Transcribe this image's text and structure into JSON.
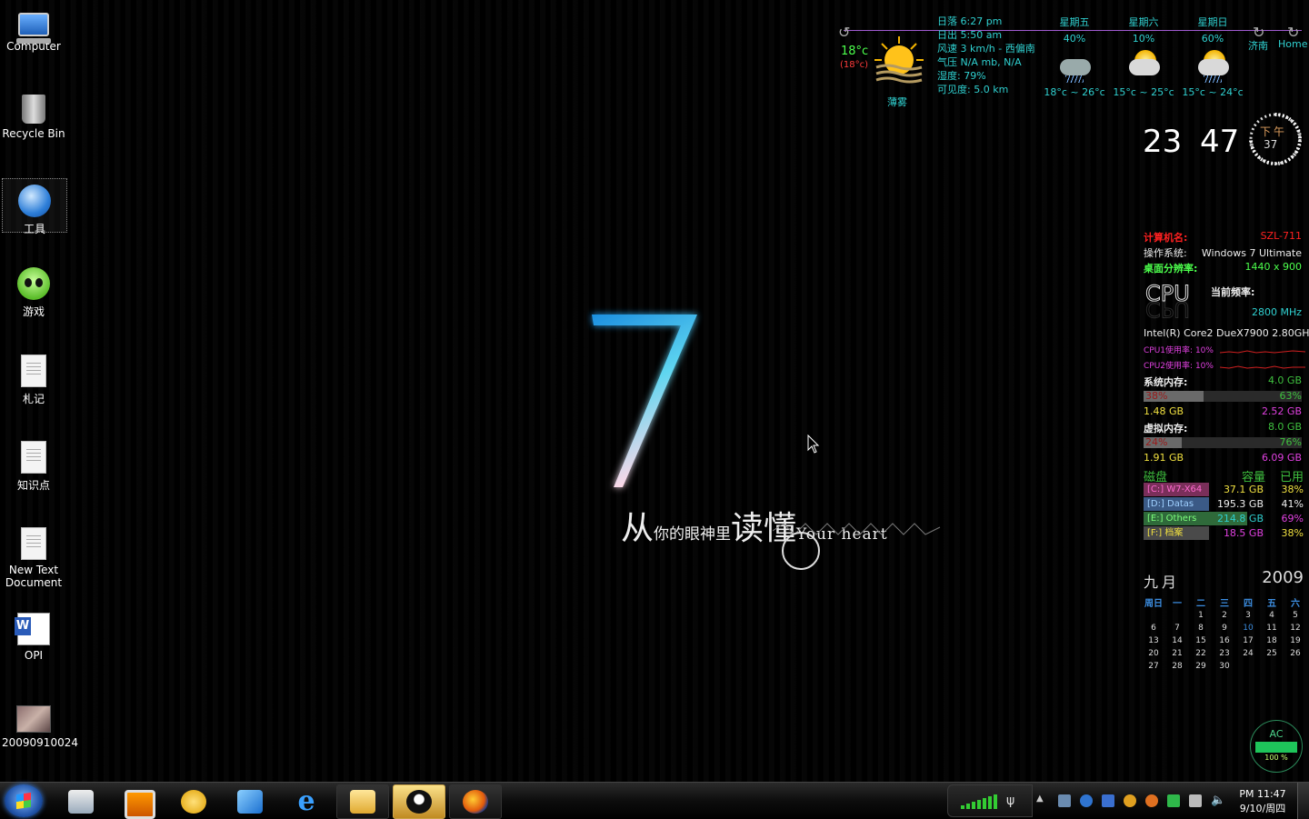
{
  "desktop_icons": [
    {
      "label": "Computer",
      "icon": "computer-icon"
    },
    {
      "label": "Recycle Bin",
      "icon": "recycle-bin-icon"
    },
    {
      "label": "工具",
      "icon": "tools-folder-icon"
    },
    {
      "label": "游戏",
      "icon": "alien-games-icon"
    },
    {
      "label": "札记",
      "icon": "text-document-icon"
    },
    {
      "label": "知识点",
      "icon": "text-document-icon"
    },
    {
      "label": "New Text Document",
      "icon": "text-document-icon"
    },
    {
      "label": "OPI",
      "icon": "word-document-icon"
    },
    {
      "label": "20090910024",
      "icon": "image-file-icon"
    }
  ],
  "wallpaper": {
    "numeral": "7",
    "slogan_big1": "从",
    "slogan_small": "你的眼神里",
    "slogan_big2": "读懂",
    "slogan_en": "Your heart"
  },
  "weather": {
    "current_temp": "18°c",
    "feels_like": "(18°c)",
    "current_condition": "薄雾",
    "sunset": "日落 6:27 pm",
    "sunrise": "日出 5:50 am",
    "wind": "风速 3 km/h - 西偏南",
    "pressure": "气压 N/A mb, N/A",
    "humidity": "湿度: 79%",
    "visibility": "可见度: 5.0 km",
    "forecast": [
      {
        "day": "星期五",
        "chance": "40%",
        "range": "18°c ~ 26°c",
        "icon": "thunderstorm-icon"
      },
      {
        "day": "星期六",
        "chance": "10%",
        "range": "15°c ~ 25°c",
        "icon": "partly-cloudy-icon"
      },
      {
        "day": "星期日",
        "chance": "60%",
        "range": "15°c ~ 24°c",
        "icon": "rain-icon"
      }
    ],
    "city": "济南",
    "home": "Home"
  },
  "clock": {
    "hour": "23",
    "minute": "47",
    "ampm": "下午",
    "second": "37"
  },
  "system": {
    "computer_name_label": "计算机名:",
    "computer_name": "SZL-711",
    "os_label": "操作系统:",
    "os": "Windows 7 Ultimate",
    "resolution_label": "桌面分辨率:",
    "resolution": "1440 x 900",
    "cpu_logo": "CPU",
    "freq_label": "当前频率:",
    "freq": "2800 MHz",
    "cpu_model": "Intel(R) Core2 DueX7900 2.80GHz",
    "cpu1_label": "CPU1使用率:",
    "cpu1": "10%",
    "cpu2_label": "CPU2使用率:",
    "cpu2": "10%",
    "ram_label": "系统内存:",
    "ram_total": "4.0 GB",
    "ram_free_pct": "38%",
    "ram_used_pct": "63%",
    "ram_fill": 0.38,
    "ram_free": "1.48 GB",
    "ram_used": "2.52 GB",
    "vmem_label": "虚拟内存:",
    "vmem_total": "8.0 GB",
    "vmem_free_pct": "24%",
    "vmem_used_pct": "76%",
    "vmem_fill": 0.24,
    "vmem_free": "1.91 GB",
    "vmem_used": "6.09 GB"
  },
  "disks": {
    "header_disk": "磁盘",
    "header_cap": "容量",
    "header_used": "已用",
    "items": [
      {
        "name": "[C:] W7-X64",
        "cap": "37.1 GB",
        "used": "38%",
        "color": "#7a2f5a",
        "text": "#ff6ad0"
      },
      {
        "name": "[D:] Datas",
        "cap": "195.3 GB",
        "used": "41%",
        "color": "#3b5a86",
        "text": "#9fd0ff"
      },
      {
        "name": "[E:] Others",
        "cap": "214.8 GB",
        "used": "69%",
        "color": "#2f6a3a",
        "text": "#7dff7d"
      },
      {
        "name": "[F:] 档案",
        "cap": "18.5 GB",
        "used": "38%",
        "color": "#4a4a4a",
        "text": "#f0e040"
      }
    ]
  },
  "calendar": {
    "month": "九月",
    "year": "2009",
    "weekdays": [
      "周日",
      "一",
      "二",
      "三",
      "四",
      "五",
      "六"
    ],
    "weeks": [
      [
        "",
        "",
        "1",
        "2",
        "3",
        "4",
        "5"
      ],
      [
        "6",
        "7",
        "8",
        "9",
        "10",
        "11",
        "12"
      ],
      [
        "13",
        "14",
        "15",
        "16",
        "17",
        "18",
        "19"
      ],
      [
        "20",
        "21",
        "22",
        "23",
        "24",
        "25",
        "26"
      ],
      [
        "27",
        "28",
        "29",
        "30",
        "",
        "",
        ""
      ]
    ],
    "today": "10"
  },
  "battery": {
    "source": "AC",
    "percent": "100 %"
  },
  "taskbar": {
    "pinned": [
      "explorer-settings-icon",
      "virtualbox-icon",
      "messenger-icon",
      "feather-app-icon",
      "internet-explorer-icon",
      "folder-icon",
      "qq-icon",
      "firefox-icon"
    ],
    "time": "PM 11:47",
    "date": "9/10/周四"
  }
}
